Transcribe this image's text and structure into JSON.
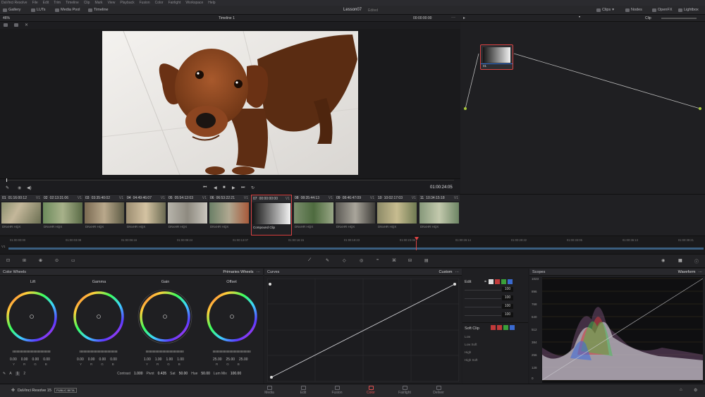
{
  "menu": [
    "DaVinci Resolve",
    "File",
    "Edit",
    "Trim",
    "Timeline",
    "Clip",
    "Mark",
    "View",
    "Playback",
    "Fusion",
    "Color",
    "Fairlight",
    "Workspace",
    "Help"
  ],
  "topbar": {
    "gallery": "Gallery",
    "luts": "LUTs",
    "media_pool": "Media Pool",
    "timeline": "Timeline",
    "project": "Lesson07",
    "status": "Edited",
    "clips": "Clips",
    "nodes": "Nodes",
    "openfx": "OpenFX",
    "lightbox": "Lightbox"
  },
  "viewerbar": {
    "zoom": "46%",
    "timeline_name": "Timeline 1",
    "timecode": "00:00:00:00",
    "mode": "Clip"
  },
  "transport": {
    "timecode": "01:00:24:05"
  },
  "node": {
    "label": "01"
  },
  "clips": [
    {
      "num": "01",
      "tc": "01:16:00:12",
      "trk": "V1",
      "name": "DNxHR HQX"
    },
    {
      "num": "02",
      "tc": "02:13:31:06",
      "trk": "V1",
      "name": "DNxHR HQX"
    },
    {
      "num": "03",
      "tc": "03:35:40:02",
      "trk": "V1",
      "name": "DNxHR HQX"
    },
    {
      "num": "04",
      "tc": "04:49:46:07",
      "trk": "V1",
      "name": "DNxHR HQX"
    },
    {
      "num": "05",
      "tc": "05:54:12:03",
      "trk": "V1",
      "name": "DNxHR HQX"
    },
    {
      "num": "06",
      "tc": "06:53:22:21",
      "trk": "V1",
      "name": "DNxHR HQX"
    },
    {
      "num": "07",
      "tc": "00:00:00:00",
      "trk": "V1",
      "name": "Compound Clip"
    },
    {
      "num": "08",
      "tc": "08:35:44:13",
      "trk": "V1",
      "name": "DNxHR HQX"
    },
    {
      "num": "09",
      "tc": "08:46:47:09",
      "trk": "V1",
      "name": "DNxHR HQX"
    },
    {
      "num": "10",
      "tc": "10:02:17:03",
      "trk": "V1",
      "name": "DNxHR HQX"
    },
    {
      "num": "11",
      "tc": "10:34:15:18",
      "trk": "V1",
      "name": "DNxHR HQX"
    }
  ],
  "ruler": {
    "ticks": [
      "01:00:00:00",
      "01:00:03:08",
      "01:00:06:16",
      "01:00:09:24",
      "01:00:13:07",
      "01:00:16:15",
      "01:00:19:23",
      "01:00:23:06",
      "01:00:26:14",
      "01:00:29:22",
      "01:00:33:05",
      "01:00:36:13",
      "01:00:39:21"
    ],
    "track_v1": "V1"
  },
  "wheels": {
    "title": "Color Wheels",
    "mode": "Primaries Wheels",
    "items": [
      {
        "name": "Lift",
        "vals": [
          "0.00",
          "0.00",
          "0.00",
          "0.00"
        ]
      },
      {
        "name": "Gamma",
        "vals": [
          "0.00",
          "0.00",
          "0.00",
          "0.00"
        ]
      },
      {
        "name": "Gain",
        "vals": [
          "1.00",
          "1.00",
          "1.00",
          "1.00"
        ]
      },
      {
        "name": "Offset",
        "vals": [
          "25.00",
          "25.00",
          "25.00"
        ]
      }
    ],
    "channels": [
      "Y",
      "R",
      "G",
      "B"
    ],
    "page_1": "1",
    "page_2": "2",
    "contrast_label": "Contrast",
    "contrast": "1.000",
    "pivot_label": "Pivot",
    "pivot": "0.435",
    "sat_label": "Sat",
    "sat": "50.00",
    "hue_label": "Hue",
    "hue": "50.00",
    "lummix_label": "Lum Mix",
    "lummix": "100.00"
  },
  "curves": {
    "title": "Curves",
    "mode": "Custom"
  },
  "edit": {
    "title": "Edit",
    "vals": [
      "100",
      "100",
      "100",
      "100"
    ],
    "softclip": "Soft Clip",
    "rows": [
      "Low",
      "Low Soft",
      "High",
      "High Soft"
    ]
  },
  "scopes": {
    "title": "Scopes",
    "mode": "Waveform",
    "labels": [
      "1023",
      "896",
      "768",
      "640",
      "512",
      "384",
      "256",
      "128",
      "0"
    ]
  },
  "pages": [
    "Media",
    "Edit",
    "Fusion",
    "Color",
    "Fairlight",
    "Deliver"
  ],
  "active_page": "Color",
  "brand": {
    "name": "DaVinci Resolve 15",
    "badge": "PUBLIC BETA"
  },
  "colors": {
    "accent": "#e05050",
    "panel": "#1f1f22"
  }
}
